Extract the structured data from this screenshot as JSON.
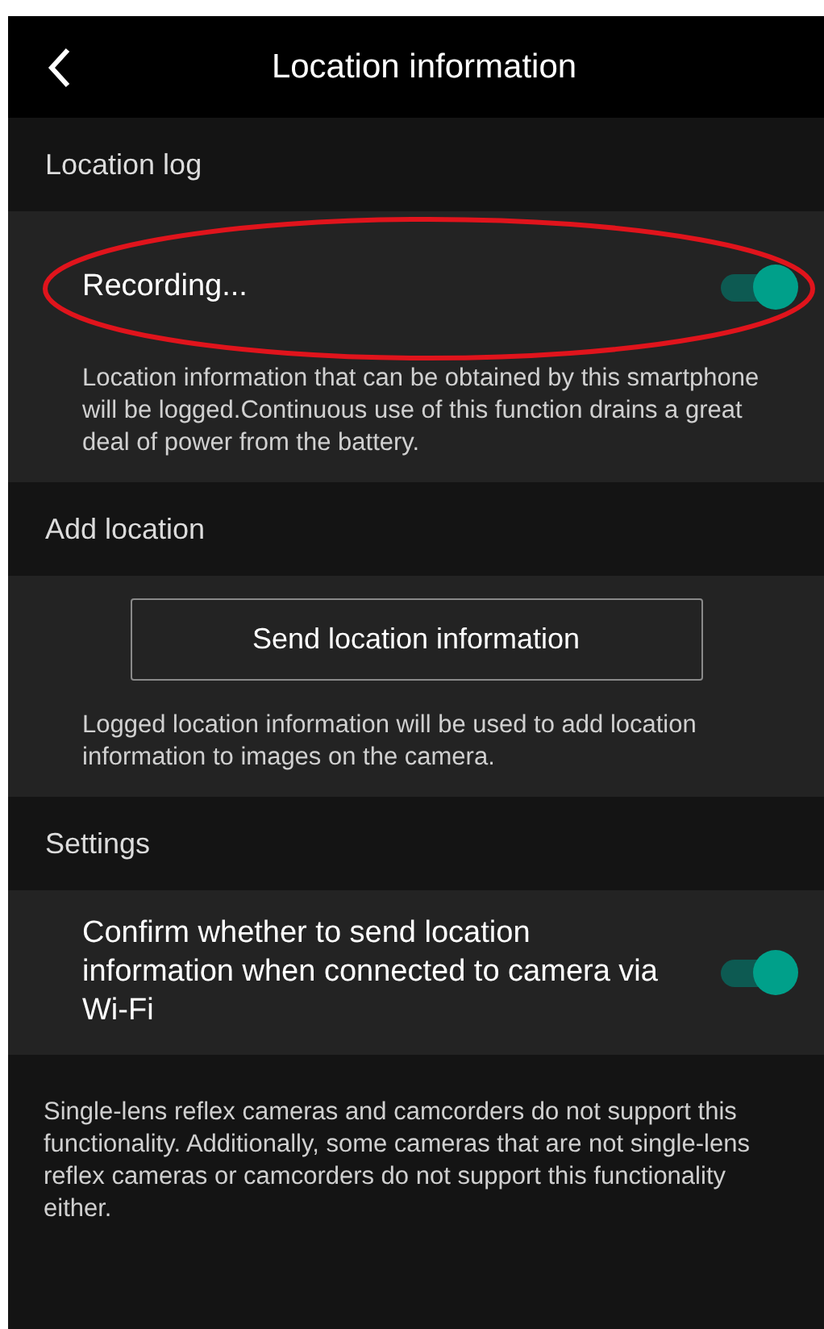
{
  "header": {
    "title": "Location information"
  },
  "sections": [
    {
      "title": "Location log",
      "toggle": {
        "label": "Recording...",
        "on": true
      },
      "description": "Location information that can be obtained by this smartphone will be logged.Continuous use of this function drains a great deal of power from the battery."
    },
    {
      "title": "Add location",
      "button": "Send location information",
      "description": "Logged location information will be used to add location information to images on the camera."
    },
    {
      "title": "Settings",
      "toggle": {
        "label": "Confirm whether to send location information when connected to camera via Wi-Fi",
        "on": true
      }
    }
  ],
  "footnote": "Single-lens reflex cameras and camcorders do not support this functionality. Additionally, some cameras that are not single-lens reflex cameras or camcorders do not support this functionality either."
}
